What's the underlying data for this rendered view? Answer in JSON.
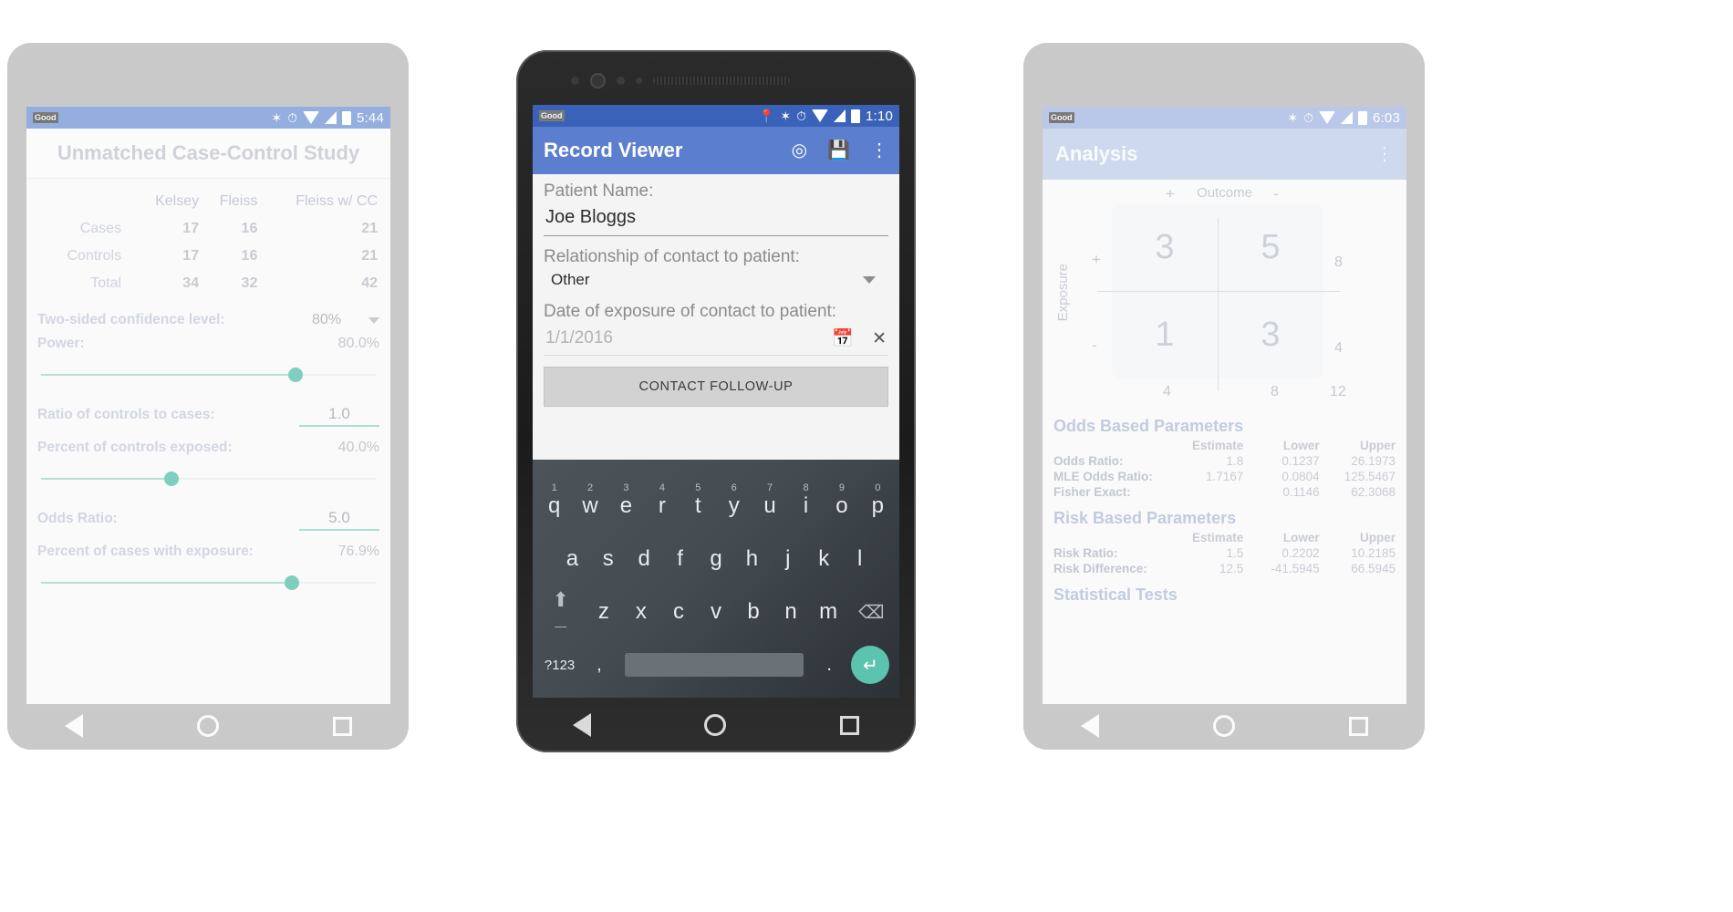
{
  "phone1": {
    "status": {
      "carrier": "Good",
      "time": "5:44",
      "icons": [
        "bluetooth-icon",
        "alarm-icon",
        "wifi-icon",
        "signal-icon",
        "battery-icon"
      ]
    },
    "app_title": "Unmatched Case-Control Study",
    "table": {
      "headers": [
        "",
        "Kelsey",
        "Fleiss",
        "Fleiss w/ CC"
      ],
      "rows": [
        {
          "label": "Cases",
          "values": [
            "17",
            "16",
            "21"
          ]
        },
        {
          "label": "Controls",
          "values": [
            "17",
            "16",
            "21"
          ]
        },
        {
          "label": "Total",
          "values": [
            "34",
            "32",
            "42"
          ]
        }
      ]
    },
    "fields": [
      {
        "label": "Two-sided confidence level:",
        "value": "80%",
        "type": "dropdown"
      },
      {
        "label": "Power:",
        "value": "80.0%",
        "type": "slider",
        "percent": 76
      },
      {
        "label": "Ratio of controls to cases:",
        "value": "1.0",
        "type": "textfield"
      },
      {
        "label": "Percent of controls exposed:",
        "value": "40.0%",
        "type": "slider",
        "percent": 39
      },
      {
        "label": "Odds Ratio:",
        "value": "5.0",
        "type": "textfield"
      },
      {
        "label": "Percent of cases with exposure:",
        "value": "76.9%",
        "type": "slider",
        "percent": 75
      }
    ],
    "nav": [
      "back-icon",
      "home-icon",
      "recents-icon"
    ]
  },
  "phone2": {
    "status": {
      "carrier": "Good",
      "time": "1:10",
      "icons": [
        "location-icon",
        "bluetooth-icon",
        "alarm-icon",
        "wifi-icon",
        "signal-icon",
        "battery-icon"
      ]
    },
    "app_title": "Record Viewer",
    "appbar_icons": [
      "gps-target-icon",
      "save-icon",
      "overflow-menu-icon"
    ],
    "form": {
      "patient_name_label": "Patient Name:",
      "patient_name_value": "Joe Bloggs",
      "relationship_label": "Relationship of contact to patient:",
      "relationship_value": "Other",
      "date_label": "Date of exposure of contact to patient:",
      "date_placeholder": "1/1/2016",
      "calendar_icon": "calendar-icon",
      "clear_icon": "clear-x-icon",
      "followup_button": "CONTACT FOLLOW-UP"
    },
    "keyboard": {
      "row1": [
        {
          "key": "q",
          "sup": "1"
        },
        {
          "key": "w",
          "sup": "2"
        },
        {
          "key": "e",
          "sup": "3"
        },
        {
          "key": "r",
          "sup": "4"
        },
        {
          "key": "t",
          "sup": "5"
        },
        {
          "key": "y",
          "sup": "6"
        },
        {
          "key": "u",
          "sup": "7"
        },
        {
          "key": "i",
          "sup": "8"
        },
        {
          "key": "o",
          "sup": "9"
        },
        {
          "key": "p",
          "sup": "0"
        }
      ],
      "row2": [
        "a",
        "s",
        "d",
        "f",
        "g",
        "h",
        "j",
        "k",
        "l"
      ],
      "row3": [
        "z",
        "x",
        "c",
        "v",
        "b",
        "n",
        "m"
      ],
      "shift_icon": "shift-icon",
      "delete_icon": "backspace-icon",
      "symbols_key": "?123",
      "comma_key": ",",
      "period_key": ".",
      "enter_icon": "enter-icon"
    },
    "nav": [
      "back-icon",
      "home-icon",
      "recents-icon"
    ]
  },
  "phone3": {
    "status": {
      "carrier": "Good",
      "time": "6:03",
      "icons": [
        "bluetooth-icon",
        "alarm-icon",
        "wifi-icon",
        "signal-icon",
        "battery-icon"
      ]
    },
    "app_title": "Analysis",
    "appbar_icons": [
      "overflow-menu-icon"
    ],
    "contingency": {
      "outcome_label": "Outcome",
      "exposure_label": "Exposure",
      "col_headers": [
        "+",
        "-"
      ],
      "row_headers": [
        "+",
        "-"
      ],
      "cells": [
        [
          "3",
          "5"
        ],
        [
          "1",
          "3"
        ]
      ],
      "row_totals": [
        "8",
        "4"
      ],
      "col_totals": [
        "4",
        "8"
      ],
      "grand_total": "12"
    },
    "odds_section": {
      "title": "Odds Based Parameters",
      "headers": [
        "",
        "Estimate",
        "Lower",
        "Upper"
      ],
      "rows": [
        {
          "label": "Odds Ratio:",
          "estimate": "1.8",
          "lower": "0.1237",
          "upper": "26.1973"
        },
        {
          "label": "MLE Odds Ratio:",
          "estimate": "1.7167",
          "lower": "0.0804",
          "upper": "125.5467"
        },
        {
          "label": "Fisher Exact:",
          "estimate": "",
          "lower": "0.1146",
          "upper": "62.3068"
        }
      ]
    },
    "risk_section": {
      "title": "Risk Based Parameters",
      "headers": [
        "",
        "Estimate",
        "Lower",
        "Upper"
      ],
      "rows": [
        {
          "label": "Risk Ratio:",
          "estimate": "1.5",
          "lower": "0.2202",
          "upper": "10.2185"
        },
        {
          "label": "Risk Difference:",
          "estimate": "12.5",
          "lower": "-41.5945",
          "upper": "66.5945"
        }
      ]
    },
    "stats_section": {
      "title": "Statistical Tests"
    },
    "nav": [
      "back-icon",
      "home-icon",
      "recents-icon"
    ]
  },
  "colors": {
    "phone1_status": "#94aee0",
    "phone2_status": "#3a62b8",
    "phone2_appbar": "#5b7fce",
    "phone3_status": "#b9c8e8",
    "phone3_appbar": "#cfd9ee",
    "slider_accent": "#7fcfbe",
    "enter_key": "#5cc3ae"
  }
}
